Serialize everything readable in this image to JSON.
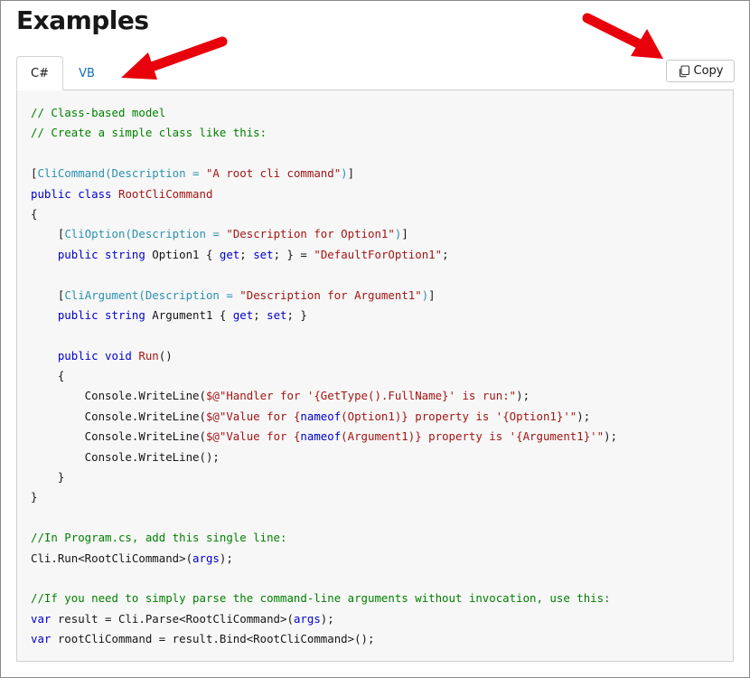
{
  "heading": "Examples",
  "tabs": [
    {
      "label": "C#",
      "selected": true
    },
    {
      "label": "VB",
      "selected": false
    }
  ],
  "copy_button": {
    "label": "Copy",
    "icon": "copy-icon"
  },
  "colors": {
    "comment": "#008000",
    "keyword": "#0000cc",
    "type": "#a31515",
    "string": "#a31515",
    "attribute": "#2b91af",
    "link": "#0f6cbd",
    "annotation_arrow": "#e8000b"
  },
  "code_lines": [
    [
      {
        "c": "c",
        "t": "// Class-based model"
      }
    ],
    [
      {
        "c": "c",
        "t": "// Create a simple class like this:"
      }
    ],
    [],
    [
      {
        "c": "",
        "t": "["
      },
      {
        "c": "a",
        "t": "CliCommand(Description = "
      },
      {
        "c": "s",
        "t": "\"A root cli command\""
      },
      {
        "c": "a",
        "t": ")"
      },
      {
        "c": "",
        "t": "]"
      }
    ],
    [
      {
        "c": "k",
        "t": "public class "
      },
      {
        "c": "t",
        "t": "RootCliCommand"
      }
    ],
    [
      {
        "c": "",
        "t": "{"
      }
    ],
    [
      {
        "c": "",
        "t": "    ["
      },
      {
        "c": "a",
        "t": "CliOption(Description = "
      },
      {
        "c": "s",
        "t": "\"Description for Option1\""
      },
      {
        "c": "a",
        "t": ")"
      },
      {
        "c": "",
        "t": "]"
      }
    ],
    [
      {
        "c": "k",
        "t": "    public string "
      },
      {
        "c": "",
        "t": "Option1 { "
      },
      {
        "c": "k",
        "t": "get"
      },
      {
        "c": "",
        "t": "; "
      },
      {
        "c": "k",
        "t": "set"
      },
      {
        "c": "",
        "t": "; } = "
      },
      {
        "c": "s",
        "t": "\"DefaultForOption1\""
      },
      {
        "c": "",
        "t": ";"
      }
    ],
    [],
    [
      {
        "c": "",
        "t": "    ["
      },
      {
        "c": "a",
        "t": "CliArgument(Description = "
      },
      {
        "c": "s",
        "t": "\"Description for Argument1\""
      },
      {
        "c": "a",
        "t": ")"
      },
      {
        "c": "",
        "t": "]"
      }
    ],
    [
      {
        "c": "k",
        "t": "    public string "
      },
      {
        "c": "",
        "t": "Argument1 { "
      },
      {
        "c": "k",
        "t": "get"
      },
      {
        "c": "",
        "t": "; "
      },
      {
        "c": "k",
        "t": "set"
      },
      {
        "c": "",
        "t": "; }"
      }
    ],
    [],
    [
      {
        "c": "k",
        "t": "    public void "
      },
      {
        "c": "t",
        "t": "Run"
      },
      {
        "c": "",
        "t": "()"
      }
    ],
    [
      {
        "c": "",
        "t": "    {"
      }
    ],
    [
      {
        "c": "",
        "t": "        Console.WriteLine("
      },
      {
        "c": "s",
        "t": "$@\"Handler for '{GetType().FullName}' is run:\""
      },
      {
        "c": "",
        "t": ");"
      }
    ],
    [
      {
        "c": "",
        "t": "        Console.WriteLine("
      },
      {
        "c": "s",
        "t": "$@\"Value for {"
      },
      {
        "c": "k",
        "t": "nameof"
      },
      {
        "c": "s",
        "t": "(Option1)} property is '{Option1}'\""
      },
      {
        "c": "",
        "t": ");"
      }
    ],
    [
      {
        "c": "",
        "t": "        Console.WriteLine("
      },
      {
        "c": "s",
        "t": "$@\"Value for {"
      },
      {
        "c": "k",
        "t": "nameof"
      },
      {
        "c": "s",
        "t": "(Argument1)} property is '{Argument1}'\""
      },
      {
        "c": "",
        "t": ");"
      }
    ],
    [
      {
        "c": "",
        "t": "        Console.WriteLine();"
      }
    ],
    [
      {
        "c": "",
        "t": "    }"
      }
    ],
    [
      {
        "c": "",
        "t": "}"
      }
    ],
    [],
    [
      {
        "c": "c",
        "t": "//In Program.cs, add this single line:"
      }
    ],
    [
      {
        "c": "",
        "t": "Cli.Run<RootCliCommand>("
      },
      {
        "c": "k",
        "t": "args"
      },
      {
        "c": "",
        "t": ");"
      }
    ],
    [],
    [
      {
        "c": "c",
        "t": "//If you need to simply parse the command-line arguments without invocation, use this:"
      }
    ],
    [
      {
        "c": "k",
        "t": "var "
      },
      {
        "c": "",
        "t": "result = Cli.Parse<RootCliCommand>("
      },
      {
        "c": "k",
        "t": "args"
      },
      {
        "c": "",
        "t": ");"
      }
    ],
    [
      {
        "c": "k",
        "t": "var "
      },
      {
        "c": "",
        "t": "rootCliCommand = result.Bind<RootCliCommand>();"
      }
    ]
  ]
}
